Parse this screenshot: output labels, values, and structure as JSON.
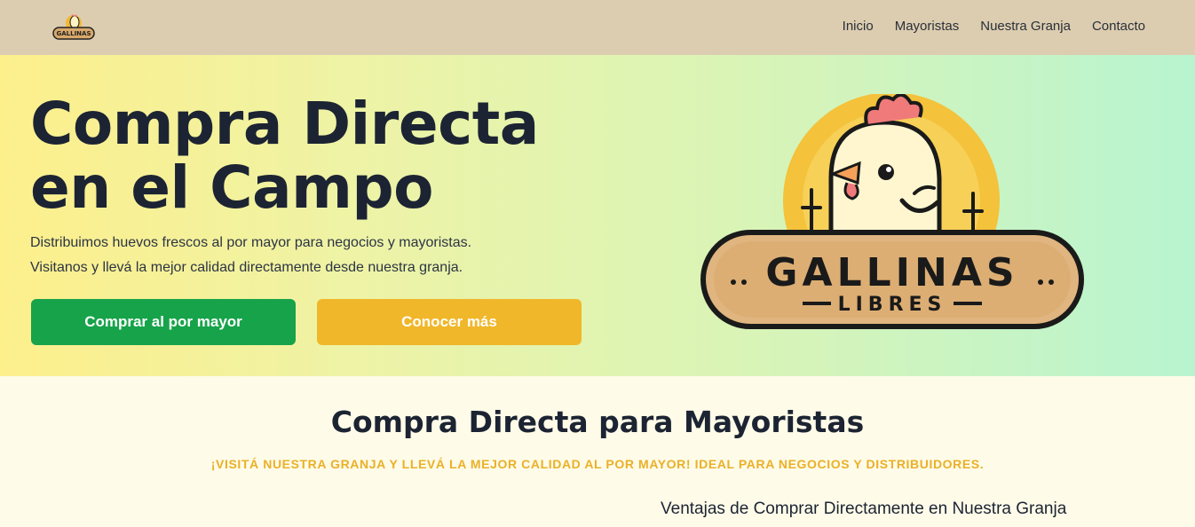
{
  "nav": {
    "logo_text": "GALLINAS",
    "links": [
      "Inicio",
      "Mayoristas",
      "Nuestra Granja",
      "Contacto"
    ]
  },
  "hero": {
    "title_line1": "Compra Directa",
    "title_line2": "en el Campo",
    "desc_line1": "Distribuimos huevos frescos al por mayor para negocios y mayoristas.",
    "desc_line2": "Visitanos y llevá la mejor calidad directamente desde nuestra granja.",
    "primary_button": "Comprar al por mayor",
    "secondary_button": "Conocer más",
    "logo": {
      "brand": "GALLINAS",
      "sub": "LIBRES"
    }
  },
  "section": {
    "title": "Compra Directa para Mayoristas",
    "tagline": "¡VISITÁ NUESTRA GRANJA Y LLEVÁ LA MEJOR CALIDAD AL POR MAYOR! IDEAL PARA NEGOCIOS Y DISTRIBUIDORES.",
    "subtitle": "Ventajas de Comprar Directamente en Nuestra Granja"
  },
  "colors": {
    "nav_bg": "#dccdb0",
    "green": "#17a34a",
    "yellow": "#f0b72a",
    "accent_text": "#eab028"
  }
}
